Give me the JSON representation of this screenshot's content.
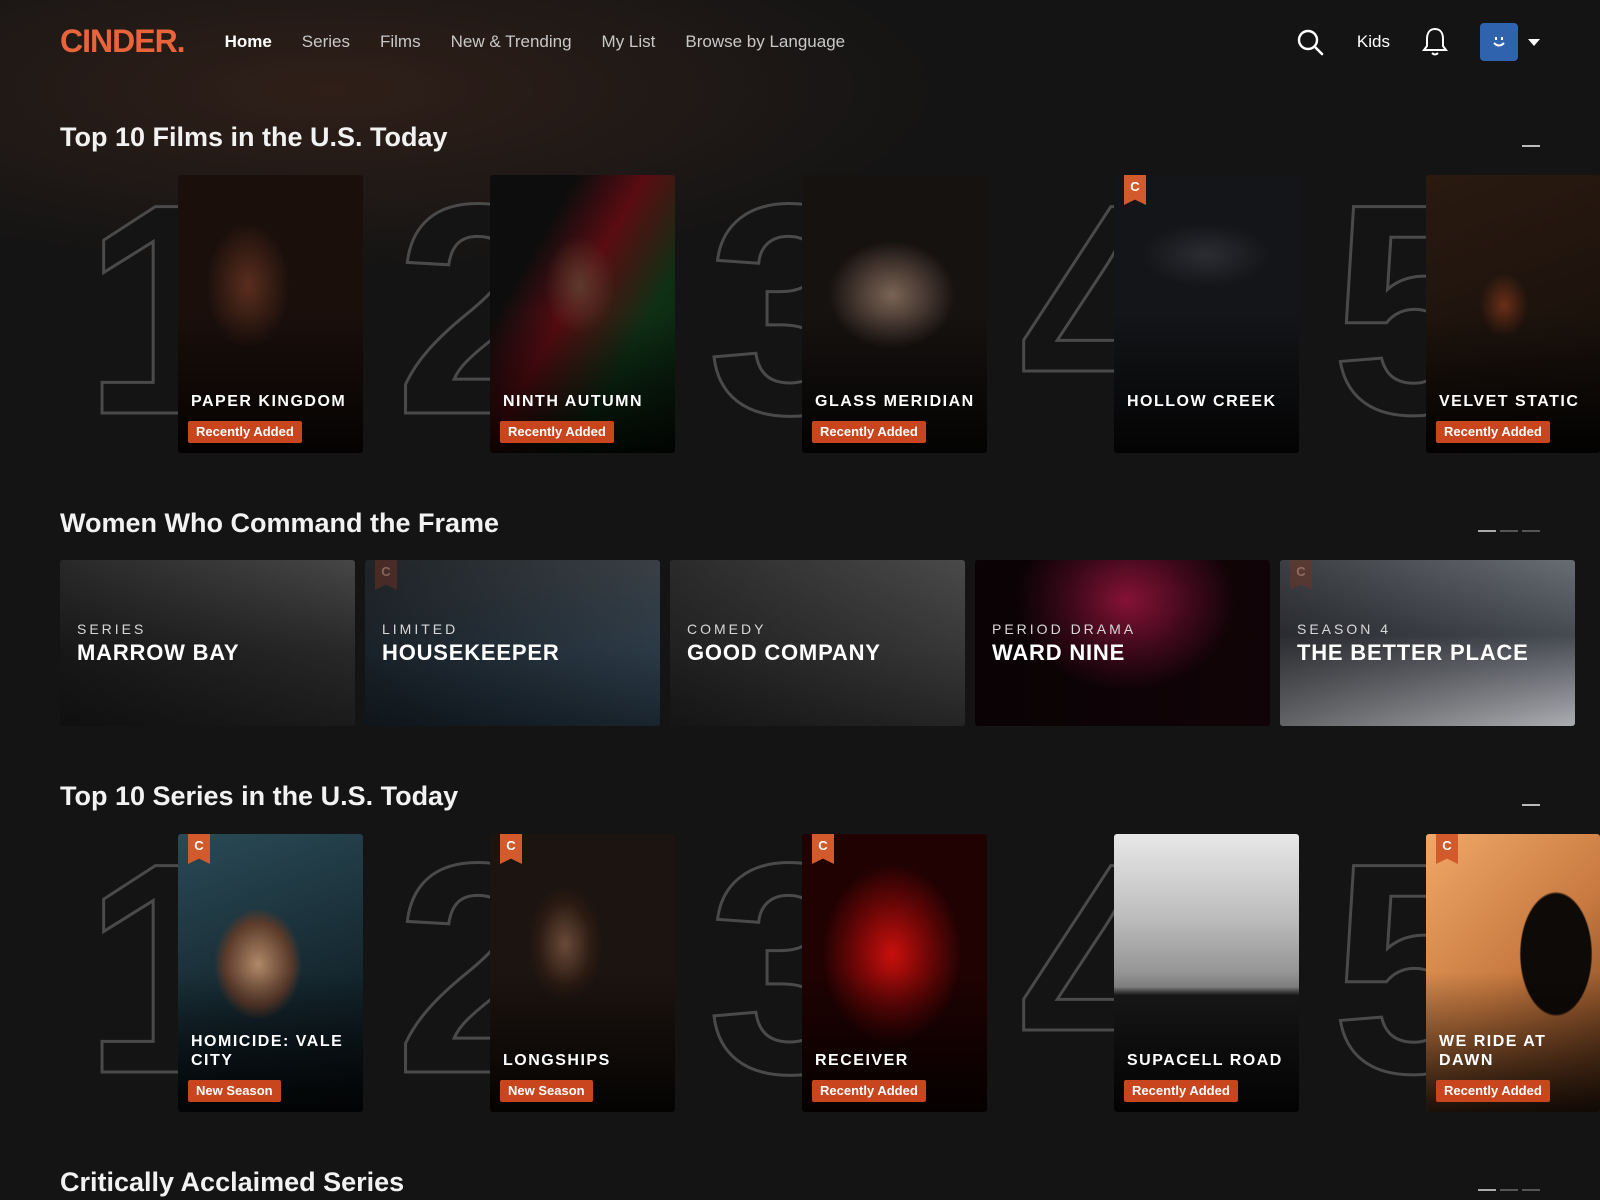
{
  "brand": {
    "logo": "CINDER.",
    "accent": "#e8643b",
    "badge_color": "#c8451d"
  },
  "nav": {
    "items": [
      {
        "label": "Home",
        "active": true
      },
      {
        "label": "Series",
        "active": false
      },
      {
        "label": "Films",
        "active": false
      },
      {
        "label": "New & Trending",
        "active": false
      },
      {
        "label": "My List",
        "active": false
      },
      {
        "label": "Browse by Language",
        "active": false
      }
    ],
    "kids_label": "Kids",
    "icons": [
      "search-icon",
      "bell-icon",
      "avatar",
      "chevron-down-icon"
    ]
  },
  "rows": {
    "top_films": {
      "title": "Top 10 Films in the U.S. Today",
      "items": [
        {
          "rank": "1",
          "title": "PAPER KINGDOM",
          "badge": "Recently Added",
          "c_flag": false
        },
        {
          "rank": "2",
          "title": "NINTH AUTUMN",
          "badge": "Recently Added",
          "c_flag": false
        },
        {
          "rank": "3",
          "title": "GLASS MERIDIAN",
          "badge": "Recently Added",
          "c_flag": false
        },
        {
          "rank": "4",
          "title": "HOLLOW CREEK",
          "badge": "",
          "c_flag": true,
          "c_label": "C"
        },
        {
          "rank": "5",
          "title": "VELVET STATIC",
          "badge": "Recently Added",
          "c_flag": false
        }
      ]
    },
    "women": {
      "title": "Women Who Command the Frame",
      "items": [
        {
          "eyebrow": "SERIES",
          "title": "MARROW BAY",
          "c_flag": false
        },
        {
          "eyebrow": "LIMITED",
          "title": "HOUSEKEEPER",
          "c_flag": true,
          "c_label": "C"
        },
        {
          "eyebrow": "COMEDY",
          "title": "GOOD COMPANY",
          "c_flag": false
        },
        {
          "eyebrow": "PERIOD DRAMA",
          "title": "WARD NINE",
          "c_flag": false
        },
        {
          "eyebrow": "SEASON 4",
          "title": "THE BETTER PLACE",
          "c_flag": true,
          "c_label": "C"
        }
      ]
    },
    "top_series": {
      "title": "Top 10 Series in the U.S. Today",
      "items": [
        {
          "rank": "1",
          "title": "HOMICIDE: VALE CITY",
          "badge": "New Season",
          "c_flag": true,
          "c_label": "C"
        },
        {
          "rank": "2",
          "title": "LONGSHIPS",
          "badge": "New Season",
          "c_flag": true,
          "c_label": "C"
        },
        {
          "rank": "3",
          "title": "RECEIVER",
          "badge": "Recently Added",
          "c_flag": true,
          "c_label": "C"
        },
        {
          "rank": "4",
          "title": "SUPACELL ROAD",
          "badge": "Recently Added",
          "c_flag": false
        },
        {
          "rank": "5",
          "title": "WE RIDE AT DAWN",
          "badge": "Recently Added",
          "c_flag": true,
          "c_label": "C"
        }
      ]
    },
    "acclaimed": {
      "title": "Critically Acclaimed Series"
    }
  }
}
